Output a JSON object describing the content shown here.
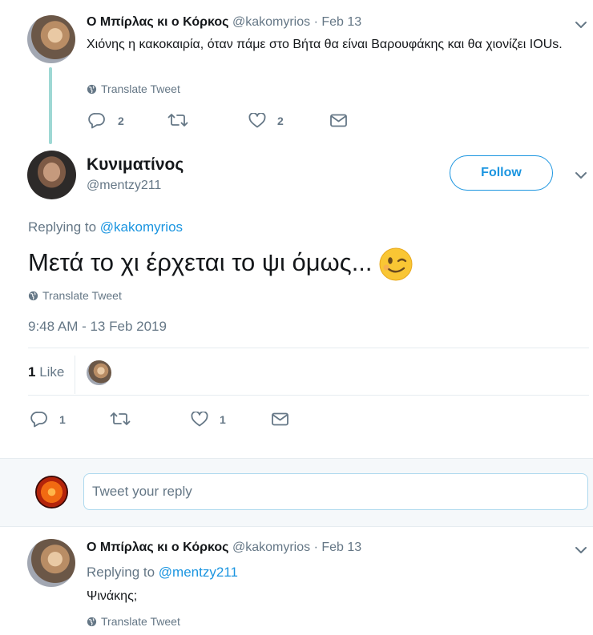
{
  "tweet1": {
    "name": "Ο Μπίρλας κι ο Κόρκος",
    "handle": "@kakomyrios",
    "sep": "·",
    "date": "Feb 13",
    "text": "Χιόνης η κακοκαιρία, όταν πάμε στο Βήτα θα είναι Βαρουφάκης και θα χιονίζει IOUs.",
    "translate": "Translate Tweet",
    "reply_count": "2",
    "like_count": "2"
  },
  "main": {
    "name": "Κυνιματίνος",
    "handle": "@mentzy211",
    "follow": "Follow",
    "replying_prefix": "Replying to",
    "replying_to": "@kakomyrios",
    "text": "Μετά το χι έρχεται το ψι όμως...",
    "translate": "Translate Tweet",
    "timestamp": "9:48 AM - 13 Feb 2019",
    "likes_count": "1",
    "likes_label": "Like",
    "reply_count": "1",
    "like_count": "1"
  },
  "compose": {
    "placeholder": "Tweet your reply"
  },
  "tweet3": {
    "name": "Ο Μπίρλας κι ο Κόρκος",
    "handle": "@kakomyrios",
    "sep": "·",
    "date": "Feb 13",
    "replying_prefix": "Replying to",
    "replying_to": "@mentzy211",
    "text": "Ψινάκης;",
    "translate": "Translate Tweet"
  },
  "colors": {
    "accent": "#1b95e0",
    "muted": "#657786",
    "thread_line": "#9ed8d4"
  }
}
